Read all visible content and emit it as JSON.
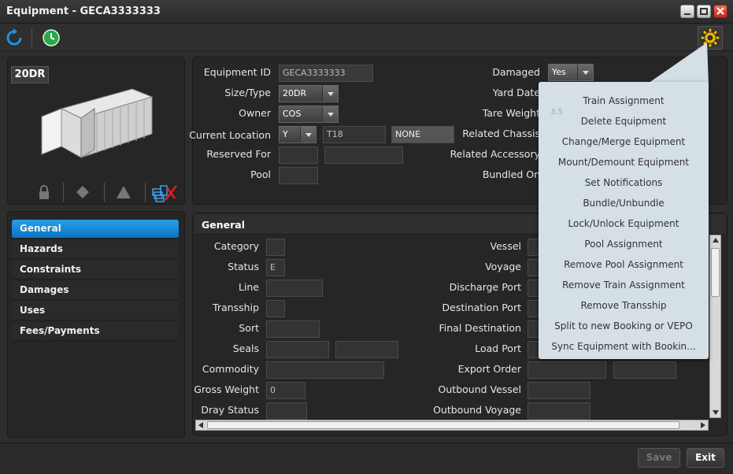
{
  "window": {
    "title": "Equipment - GECA3333333"
  },
  "equipment": {
    "type_badge": "20DR"
  },
  "id_form": {
    "equipment_id_label": "Equipment ID",
    "equipment_id_value": "GECA3333333",
    "size_type_label": "Size/Type",
    "size_type_value": "20DR",
    "owner_label": "Owner",
    "owner_value": "COS",
    "current_location_label": "Current Location",
    "location_type_value": "Y",
    "location_slot_value": "T18",
    "location_extra_value": "NONE",
    "reserved_for_label": "Reserved For",
    "pool_label": "Pool",
    "damaged_label": "Damaged",
    "damaged_value": "Yes",
    "yard_date_label": "Yard Date",
    "tare_weight_label": "Tare Weight",
    "tare_weight_value": "3.5",
    "related_chassis_label": "Related Chassis",
    "related_accessory_label": "Related Accessory",
    "bundled_on_label": "Bundled On"
  },
  "nav": {
    "items": [
      {
        "label": "General"
      },
      {
        "label": "Hazards"
      },
      {
        "label": "Constraints"
      },
      {
        "label": "Damages"
      },
      {
        "label": "Uses"
      },
      {
        "label": "Fees/Payments"
      }
    ]
  },
  "general": {
    "header": "General",
    "category_label": "Category",
    "status_label": "Status",
    "status_value": "E",
    "line_label": "Line",
    "tranship_label": "Transship",
    "sort_label": "Sort",
    "seals_label": "Seals",
    "commodity_label": "Commodity",
    "gross_weight_label": "Gross Weight",
    "gross_weight_value": "0",
    "dray_status_label": "Dray Status",
    "vessel_label": "Vessel",
    "voyage_label": "Voyage",
    "discharge_port_label": "Discharge Port",
    "destination_port_label": "Destination Port",
    "final_destination_label": "Final Destination",
    "load_port_label": "Load Port",
    "export_order_label": "Export Order",
    "outbound_vessel_label": "Outbound Vessel",
    "outbound_voyage_label": "Outbound Voyage"
  },
  "menu": {
    "items": [
      {
        "label": "Train Assignment"
      },
      {
        "label": "Delete Equipment"
      },
      {
        "label": "Change/Merge Equipment"
      },
      {
        "label": "Mount/Demount Equipment"
      },
      {
        "label": "Set Notifications"
      },
      {
        "label": "Bundle/Unbundle"
      },
      {
        "label": "Lock/Unlock Equipment"
      },
      {
        "label": "Pool Assignment"
      },
      {
        "label": "Remove Pool Assignment"
      },
      {
        "label": "Remove Train Assignment"
      },
      {
        "label": "Remove Transship"
      },
      {
        "label": "Split to new Booking or VEPO"
      },
      {
        "label": "Sync Equipment with Bookin..."
      }
    ]
  },
  "footer": {
    "save_label": "Save",
    "exit_label": "Exit"
  },
  "colors": {
    "accent": "#0b73c4",
    "menu_bg": "#d5dfe6",
    "window_bg": "#2d2d2d"
  },
  "icons": [
    "refresh-icon",
    "history-icon",
    "gear-icon",
    "lock-icon",
    "diamond-icon",
    "triangle-icon",
    "stack-icon",
    "minimize-icon",
    "maximize-icon",
    "close-icon"
  ]
}
